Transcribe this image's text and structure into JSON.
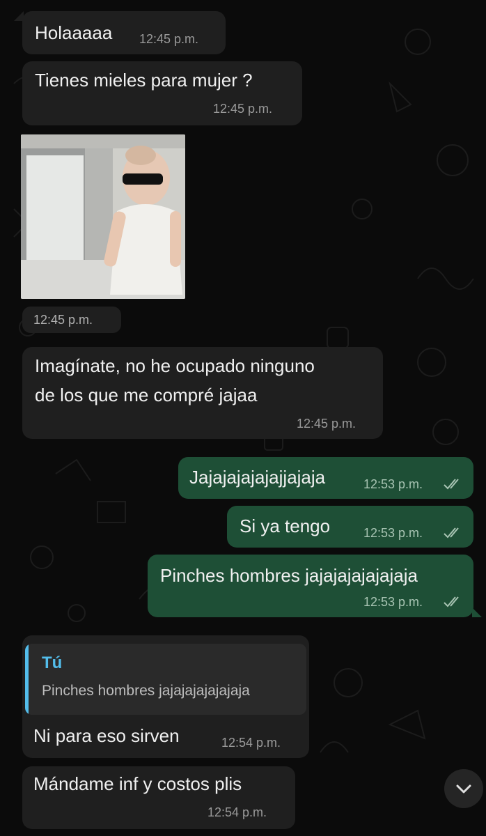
{
  "messages": [
    {
      "text": "Holaaaaa",
      "time": "12:45 p.m."
    },
    {
      "text": "Tienes mieles para mujer ?",
      "time": "12:45 p.m."
    },
    {
      "photo_time": "12:45 p.m."
    },
    {
      "text_line1": "Imagínate, no he ocupado ninguno",
      "text_line2": "de los que me compré  jajaa",
      "time": "12:45 p.m."
    },
    {
      "text": "Jajajajajajajjajaja",
      "time": "12:53 p.m."
    },
    {
      "text": "Si ya tengo",
      "time": "12:53 p.m."
    },
    {
      "text": "Pinches hombres jajajajajajajaja",
      "time": "12:53 p.m."
    },
    {
      "quote_author": "Tú",
      "quote_text": "Pinches hombres jajajajajajajaja",
      "text": "Ni para eso sirven",
      "time": "12:54 p.m."
    },
    {
      "text": "Mándame inf y costos plis",
      "time": "12:54 p.m."
    }
  ],
  "colors": {
    "incoming": "#1f1f1f",
    "outgoing": "#1e4f36",
    "accent": "#53bdeb",
    "background": "#0b0b0b"
  },
  "icons": {
    "read_receipt": "double-check-icon",
    "scroll": "chevron-down-icon"
  }
}
